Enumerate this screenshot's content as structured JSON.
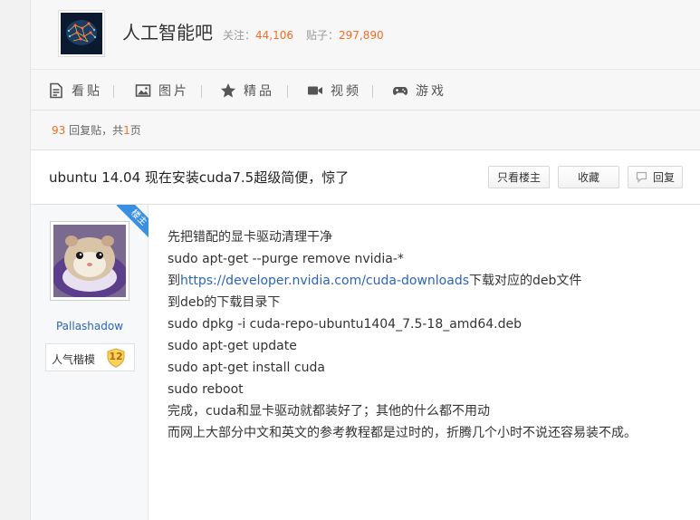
{
  "forum": {
    "name": "人工智能吧",
    "follow_label": "关注：",
    "follow_count": "44,106",
    "posts_label": "贴子：",
    "posts_count": "297,890",
    "logo_icon": "neural-brain-logo"
  },
  "nav": {
    "items": [
      {
        "label": "看贴",
        "icon": "document-icon"
      },
      {
        "label": "图片",
        "icon": "image-icon"
      },
      {
        "label": "精品",
        "icon": "star-icon"
      },
      {
        "label": "视频",
        "icon": "video-icon"
      },
      {
        "label": "游戏",
        "icon": "gamepad-icon"
      }
    ]
  },
  "reply_info": {
    "count": "93",
    "text_a": " 回复贴，共",
    "pages": "1",
    "text_b": "页"
  },
  "thread": {
    "title": "ubuntu 14.04 现在安装cuda7.5超级简便，惊了",
    "buttons": {
      "only_op": "只看楼主",
      "collect": "收藏",
      "reply": "回复"
    }
  },
  "post": {
    "badge": "楼主",
    "author": "Pallashadow",
    "level_name": "人气楷模",
    "level": "12",
    "lines": [
      "先把错配的显卡驱动清理干净",
      "sudo apt-get --purge remove nvidia-*"
    ],
    "link_line": {
      "prefix": "到",
      "url": "https://developer.nvidia.com/cuda-downloads",
      "suffix": "下载对应的deb文件"
    },
    "lines_after": [
      "到deb的下载目录下",
      "sudo dpkg -i cuda-repo-ubuntu1404_7.5-18_amd64.deb",
      "sudo apt-get update",
      "sudo apt-get install cuda",
      "sudo reboot",
      "完成，cuda和显卡驱动就都装好了；其他的什么都不用动",
      "而网上大部分中文和英文的参考教程都是过时的，折腾几个小时不说还容易装不成。"
    ]
  },
  "colors": {
    "accent_orange": "#f36c21",
    "link_blue": "#2d64b3",
    "badge_blue": "#3b8fe0"
  }
}
